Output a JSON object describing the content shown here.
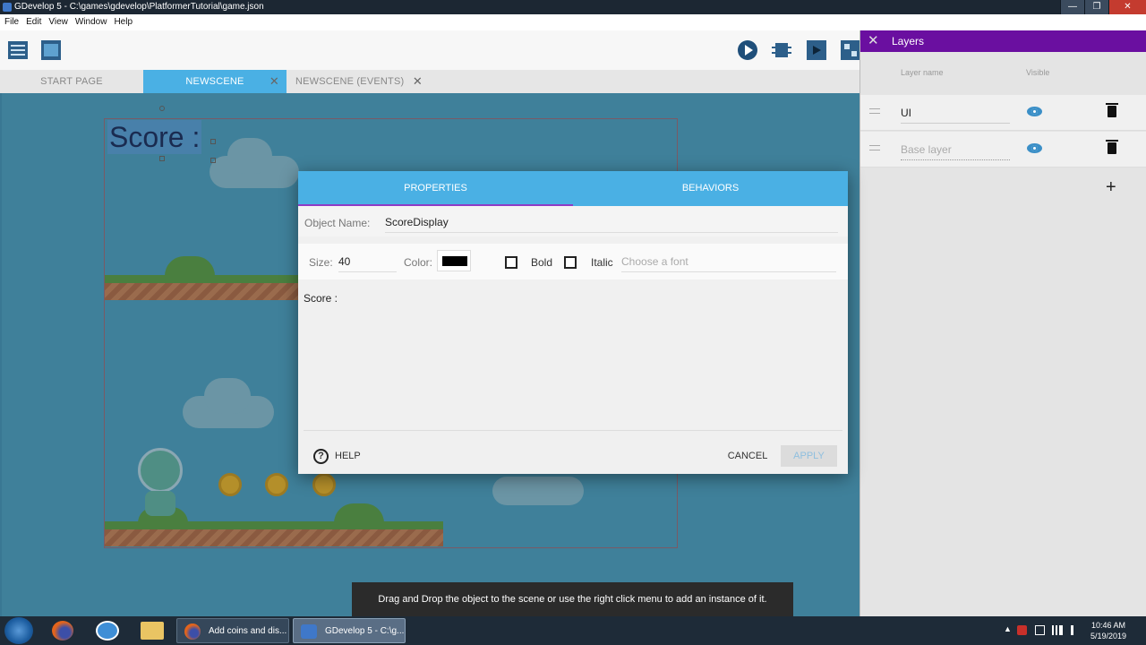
{
  "window": {
    "title": "GDevelop 5 - C:\\games\\gdevelop\\PlatformerTutorial\\game.json",
    "controls": [
      "—",
      "❐",
      "✕"
    ]
  },
  "menu": [
    "File",
    "Edit",
    "View",
    "Window",
    "Help"
  ],
  "tabs": [
    {
      "label": "START PAGE"
    },
    {
      "label": "NEWSCENE",
      "close": "✕"
    },
    {
      "label": "NEWSCENE (EVENTS)",
      "close": "✕"
    }
  ],
  "scene": {
    "score_text": "Score :"
  },
  "layers_panel": {
    "title": "Layers",
    "col_name": "Layer name",
    "col_visible": "Visible",
    "layers": [
      {
        "name": "UI"
      },
      {
        "name": "Base layer"
      }
    ],
    "add": "+"
  },
  "dialog": {
    "tab_properties": "PROPERTIES",
    "tab_behaviors": "BEHAVIORS",
    "object_name_label": "Object Name:",
    "object_name_value": "ScoreDisplay",
    "size_label": "Size:",
    "size_value": "40",
    "color_label": "Color:",
    "color_value": "#000000",
    "bold_label": "Bold",
    "italic_label": "Italic",
    "font_placeholder": "Choose a font",
    "text_value": "Score :",
    "help": "HELP",
    "cancel": "CANCEL",
    "apply": "APPLY"
  },
  "snackbar": "Drag and Drop the object to the scene or use the right click menu to add an instance of it.",
  "taskbar": {
    "apps": [
      {
        "label": "Add coins and dis..."
      },
      {
        "label": "GDevelop 5 - C:\\g..."
      }
    ],
    "time": "10:46 AM",
    "date": "5/19/2019"
  },
  "colors": {
    "accent": "#4ab0e4",
    "layers_header": "#6a0fa0",
    "tab_underline": "#8f3bc5"
  }
}
